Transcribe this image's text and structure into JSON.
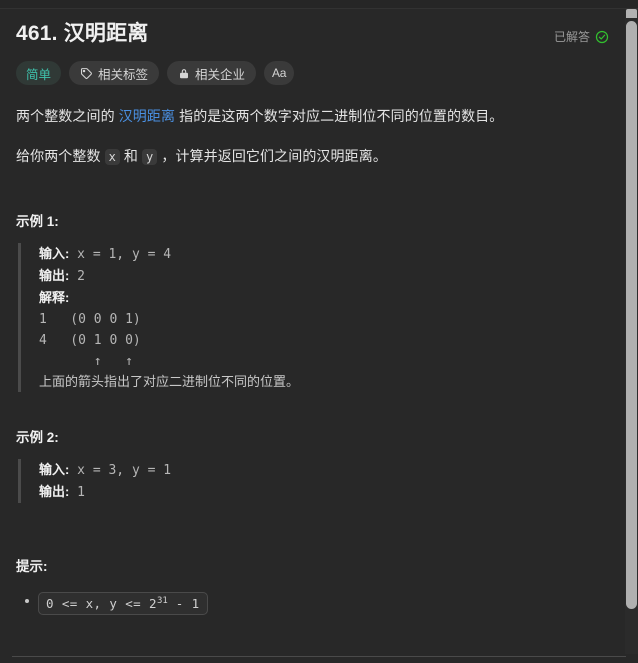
{
  "header": {
    "title": "461. 汉明距离",
    "status_label": "已解答",
    "status_icon": "check-circle-icon",
    "status_color": "#32c02f"
  },
  "badges": {
    "difficulty": {
      "label": "简单",
      "color": "#3fc4ae"
    },
    "tags": {
      "label": "相关标签",
      "icon": "tag-icon"
    },
    "companies": {
      "label": "相关企业",
      "icon": "lock-icon"
    },
    "font_size": {
      "label": "Aa",
      "icon": "font-size-icon"
    }
  },
  "description": {
    "p1_before": "两个整数之间的 ",
    "p1_link": "汉明距离",
    "p1_after": " 指的是这两个数字对应二进制位不同的位置的数目。",
    "p2_before": "给你两个整数 ",
    "p2_code_x": "x",
    "p2_mid": " 和 ",
    "p2_code_y": "y",
    "p2_after": " ，计算并返回它们之间的汉明距离。"
  },
  "examples": [
    {
      "title": "示例 1:",
      "input_label": "输入:",
      "input_value": " x = 1, y = 4",
      "output_label": "输出:",
      "output_value": " 2",
      "explain_label": "解释:",
      "explain_lines": [
        "1   (0 0 0 1)",
        "4   (0 1 0 0)",
        "       ↑   ↑"
      ],
      "explain_note": "上面的箭头指出了对应二进制位不同的位置。"
    },
    {
      "title": "示例 2:",
      "input_label": "输入:",
      "input_value": " x = 3, y = 1",
      "output_label": "输出:",
      "output_value": " 1"
    }
  ],
  "hints": {
    "title": "提示:",
    "items": [
      {
        "code_before": "0 <= x, y <= 2",
        "code_sup": "31",
        "code_after": " - 1"
      }
    ]
  },
  "scrollbar": {
    "position": "right",
    "thumb_visible": true
  }
}
